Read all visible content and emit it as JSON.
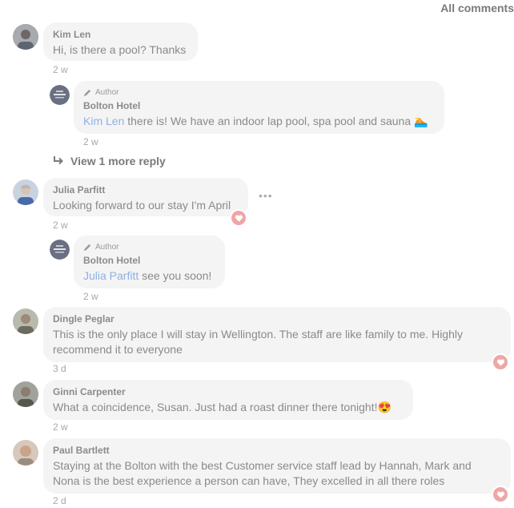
{
  "header": {
    "sort_label": "All comments"
  },
  "comments": [
    {
      "name": "Kim Len",
      "text": "Hi, is there a pool? Thanks",
      "time": "2 w"
    },
    {
      "author_badge": "Author",
      "name": "Bolton Hotel",
      "mention": "Kim Len",
      "text": " there is! We have an indoor lap pool, spa pool and sauna 🏊",
      "time": "2 w"
    },
    {
      "view_more": "View 1 more reply"
    },
    {
      "name": "Julia Parfitt",
      "text": "Looking forward to our stay I'm April",
      "time": "2 w"
    },
    {
      "author_badge": "Author",
      "name": "Bolton Hotel",
      "mention": "Julia Parfitt",
      "text": " see you soon!",
      "time": "2 w"
    },
    {
      "name": "Dingle Peglar",
      "text": "This is the only place I will stay in Wellington. The staff are like family to me. Highly recommend it to everyone",
      "time": "3 d"
    },
    {
      "name": "Ginni Carpenter",
      "text": "What a coincidence, Susan. Just had a roast dinner there tonight!😍",
      "time": "2 w"
    },
    {
      "name": "Paul Bartlett",
      "text": "Staying at the Bolton with the best Customer service staff lead by Hannah, Mark and Nona is the best experience a person can have, They excelled in all there roles",
      "time": "2 d"
    }
  ],
  "icons": {
    "heart": "heart-icon",
    "pencil": "pencil-icon",
    "reply_arrow": "reply-arrow-icon",
    "more": "more-options-icon"
  },
  "colors": {
    "heart": "#efa6a6",
    "mention": "#8fb0e3",
    "bubble": "#f4f4f4"
  }
}
